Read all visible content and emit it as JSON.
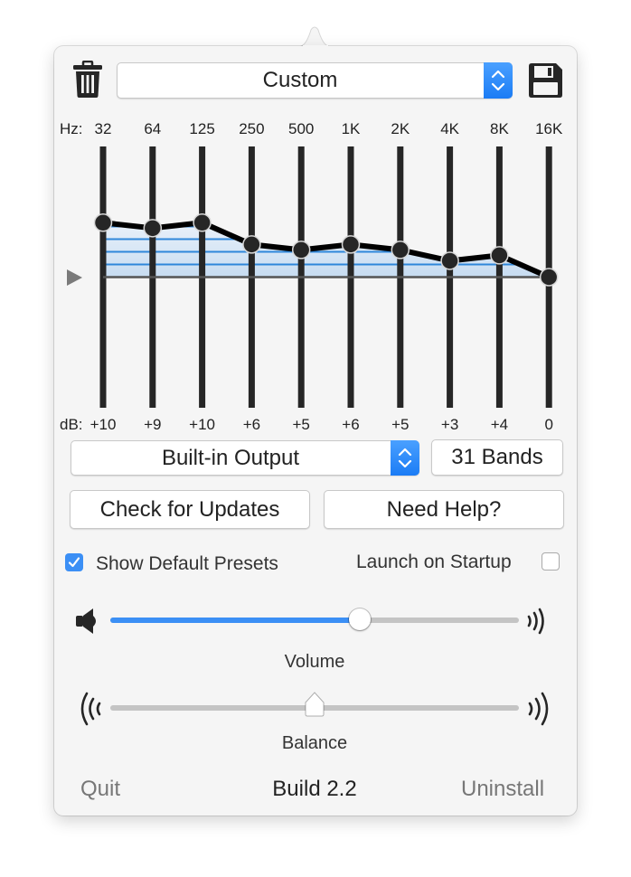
{
  "preset": {
    "selected": "Custom"
  },
  "toolbar": {
    "delete_icon": "trash-icon",
    "save_icon": "floppy-disk-icon"
  },
  "equalizer": {
    "hz_prefix": "Hz:",
    "db_prefix": "dB:",
    "range_db": [
      -24,
      24
    ],
    "bands": [
      {
        "freq": "32",
        "gain": 10,
        "gain_label": "+10"
      },
      {
        "freq": "64",
        "gain": 9,
        "gain_label": "+9"
      },
      {
        "freq": "125",
        "gain": 10,
        "gain_label": "+10"
      },
      {
        "freq": "250",
        "gain": 6,
        "gain_label": "+6"
      },
      {
        "freq": "500",
        "gain": 5,
        "gain_label": "+5"
      },
      {
        "freq": "1K",
        "gain": 6,
        "gain_label": "+6"
      },
      {
        "freq": "2K",
        "gain": 5,
        "gain_label": "+5"
      },
      {
        "freq": "4K",
        "gain": 3,
        "gain_label": "+3"
      },
      {
        "freq": "8K",
        "gain": 4,
        "gain_label": "+4"
      },
      {
        "freq": "16K",
        "gain": 0,
        "gain_label": "0"
      }
    ],
    "colors": {
      "track": "#262626",
      "curve": "#000000",
      "fill": "#cfe3f5",
      "fill_line": "#2f87da"
    }
  },
  "output": {
    "device": "Built-in Output",
    "bands_button": "31 Bands"
  },
  "buttons": {
    "check_updates": "Check for Updates",
    "need_help": "Need Help?"
  },
  "options": {
    "show_default_presets": {
      "label": "Show Default Presets",
      "checked": true
    },
    "launch_on_startup": {
      "label": "Launch on Startup",
      "checked": false
    }
  },
  "volume": {
    "label": "Volume",
    "value": 0.61,
    "accent": "#3b8ff5"
  },
  "balance": {
    "label": "Balance",
    "value": 0.5
  },
  "footer": {
    "quit": "Quit",
    "build": "Build 2.2",
    "uninstall": "Uninstall"
  }
}
